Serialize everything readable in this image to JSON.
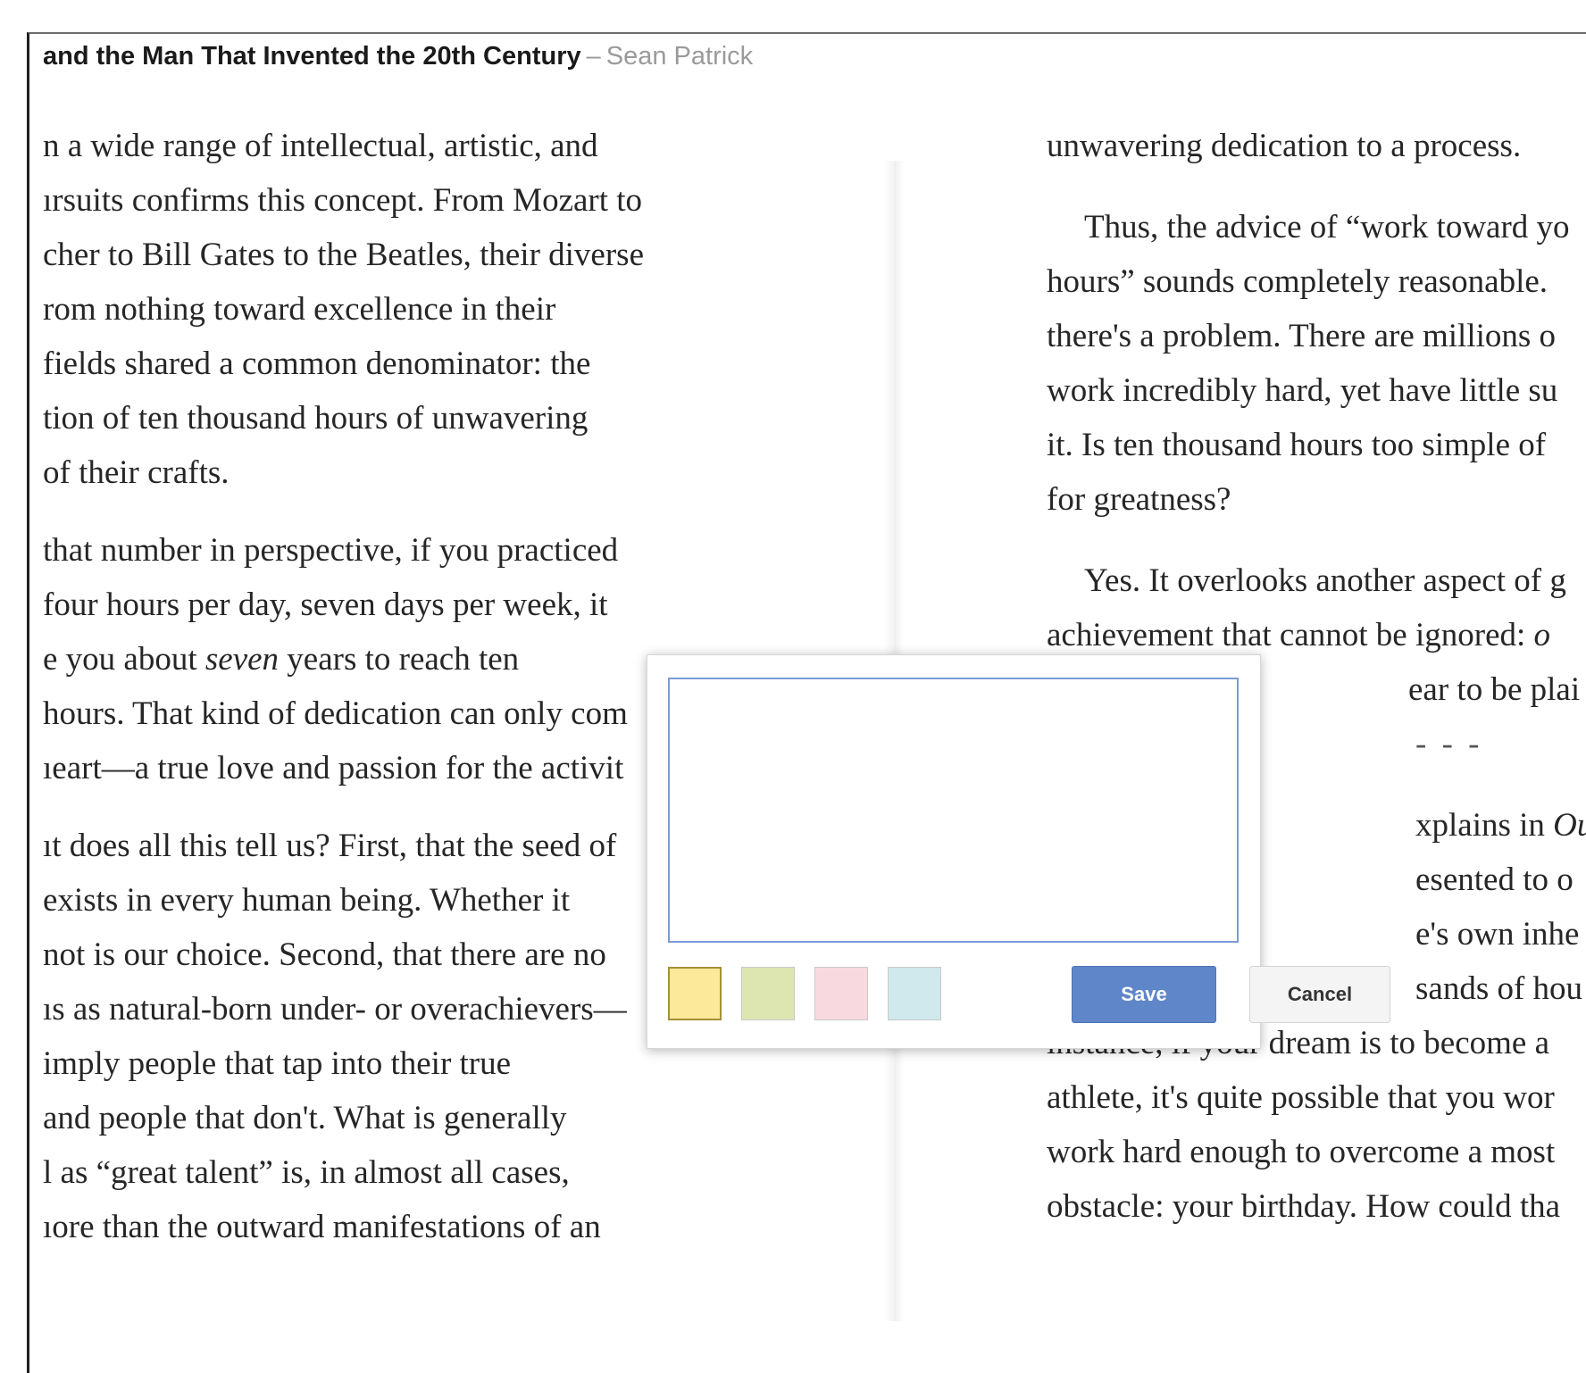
{
  "header": {
    "book_title": "and the Man That Invented the 20th Century",
    "separator": "–",
    "author": "Sean Patrick"
  },
  "left_page": {
    "p1": [
      "n a wide range of intellectual, artistic, and",
      "ırsuits confirms this concept. From Mozart to",
      "cher to Bill Gates to the Beatles, their diverse",
      "rom nothing toward excellence in their",
      " fields shared a common denominator: the",
      "tion of ten thousand hours of unwavering",
      " of their crafts."
    ],
    "p2_l1": "that number in perspective, if you practiced",
    "p2_l2": " four hours per day, seven days per week, it",
    "p2_l3_pre": "e you about ",
    "p2_l3_em": "seven",
    "p2_l3_post": " years to reach ten",
    "p2_l4": "hours. That kind of dedication can only com",
    "p2_l5": "ıeart—a true love and passion for the activit",
    "p3": [
      "ıt does all this tell us? First, that the seed of",
      "exists in every human being. Whether it",
      " not is our choice. Second, that there are no",
      "ıs as natural-born under- or overachievers—",
      "imply people that tap into their true",
      " and people that don't. What is generally",
      "l as “great talent” is, in almost all cases,",
      "ıore than the outward manifestations of an"
    ]
  },
  "right_page": {
    "p1": "unwavering dedication to a process.",
    "p2": [
      "Thus, the advice of “work toward yo",
      "hours” sounds completely reasonable.",
      "there's a problem. There are millions o",
      "work incredibly hard, yet have little su",
      "it. Is ten thousand hours too simple of",
      "for greatness?"
    ],
    "p3_l1": "Yes. It overlooks another aspect of g",
    "p3_l2_pre": "achievement that cannot be ignored: ",
    "p3_l2_em": "o",
    "p3_l3": "ear to be plai",
    "divider": "- - -",
    "p4_l1_pre": "xplains in ",
    "p4_l1_em": "Ou",
    "p4_l2": "esented to o",
    "p4_l3": "e's own inhe",
    "p4_l4": "sands of hou",
    "p4_tail": [
      "instance, if your dream is to become a",
      "athlete, it's quite possible that you wor",
      "work hard enough to overcome a most",
      "obstacle: your birthday. How could tha"
    ]
  },
  "note_popup": {
    "input_value": "",
    "swatches": [
      {
        "name": "yellow",
        "color": "#fce99a",
        "selected": true
      },
      {
        "name": "green",
        "color": "#dde6b0",
        "selected": false
      },
      {
        "name": "pink",
        "color": "#f9d9e0",
        "selected": false
      },
      {
        "name": "blue",
        "color": "#cfe9ec",
        "selected": false
      }
    ],
    "save_label": "Save",
    "cancel_label": "Cancel"
  }
}
